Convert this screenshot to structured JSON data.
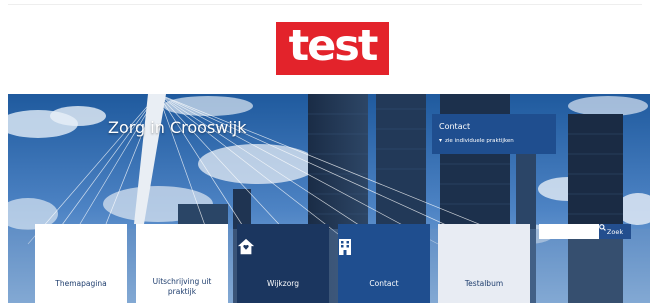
{
  "header": {
    "logo_text": "test"
  },
  "hero": {
    "title": "Zorg in Crooswijk",
    "contact": {
      "title": "Contact",
      "link": "zie individuele praktijken"
    }
  },
  "search": {
    "placeholder": "",
    "button_label": "Zoek"
  },
  "tiles": [
    {
      "label": "Themapagina",
      "icon": null
    },
    {
      "label": "Uitschrijving uit praktijk",
      "icon": null
    },
    {
      "label": "Wijkzorg",
      "icon": "house-icon"
    },
    {
      "label": "Contact",
      "icon": "building-icon"
    },
    {
      "label": "Testalbum",
      "icon": null
    }
  ],
  "colors": {
    "logo_red": "#e3232b",
    "navy": "#1b365f",
    "blue": "#1f4e8f"
  }
}
